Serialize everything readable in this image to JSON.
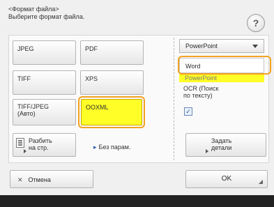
{
  "header": {
    "breadcrumb": "<Формат файла>",
    "instruction": "Выберите формат файла.",
    "help_label": "?"
  },
  "formats": {
    "jpeg": "JPEG",
    "pdf": "PDF",
    "tiff": "TIFF",
    "xps": "XPS",
    "tiff_jpeg_line1": "TIFF/JPEG",
    "tiff_jpeg_line2": "(Авто)",
    "ooxml": "OOXML",
    "selected": "OOXML"
  },
  "split": {
    "line1": "Разбить",
    "line2": "на стр.",
    "status": "Без парам."
  },
  "ooxml_options": {
    "dropdown_value": "PowerPoint",
    "options": [
      "Word",
      "PowerPoint"
    ],
    "highlighted_option": "Word",
    "ocr_line1": "OCR (Поиск",
    "ocr_line2": "по тексту)",
    "ocr_checkbox_mark": "✓",
    "details_line1": "Задать",
    "details_line2": "детали"
  },
  "footer": {
    "cancel_label": "Отмена",
    "ok_label": "OK"
  },
  "colors": {
    "selected_fill": "#ffff27",
    "focus_ring": "#f3a21f",
    "bottom_bar": "#222222"
  }
}
